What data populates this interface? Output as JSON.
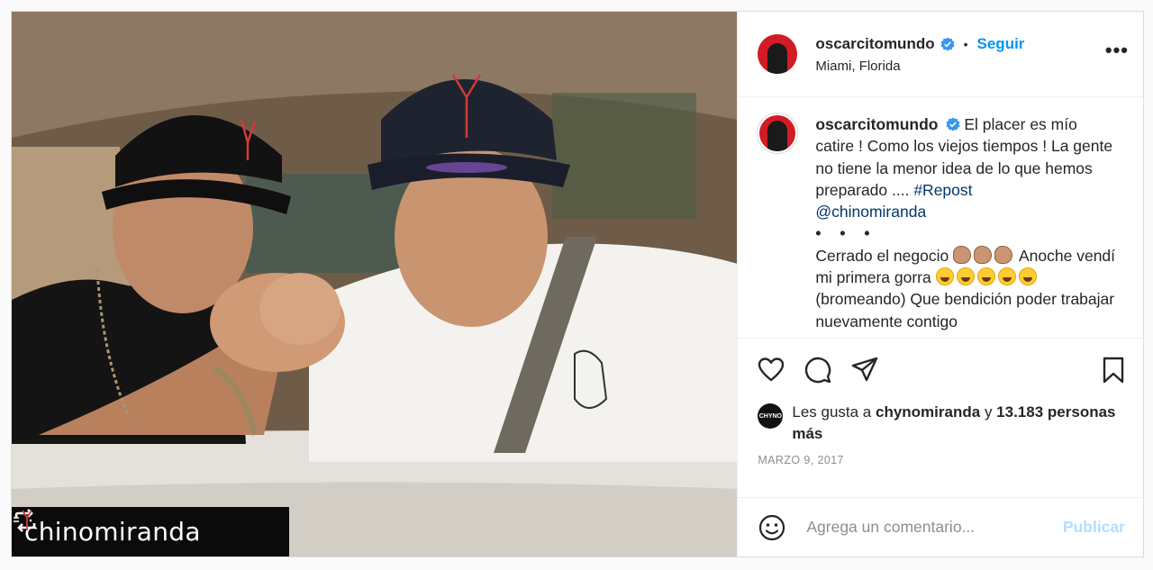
{
  "post": {
    "username": "oscarcitomundo",
    "follow_label": "Seguir",
    "location": "Miami, Florida",
    "more_icon": "more-horizontal-icon",
    "photo": {
      "repost_user": "chinomiranda"
    },
    "caption": {
      "username": "oscarcitomundo",
      "text1": "El placer es mío catire ! Como los viejos tiempos ! La gente no tiene la menor idea de lo que hemos preparado .... ",
      "hashtag": "#Repost",
      "mention": "@chinomiranda",
      "dots": "• • •",
      "text2": "Cerrado el negocio",
      "text3": " Anoche vendí mi primera gorra ",
      "text4": "(bromeando) Que bendición poder trabajar nuevamente contigo"
    },
    "actions": {
      "like_icon": "heart-icon",
      "comment_icon": "comment-icon",
      "share_icon": "share-icon",
      "save_icon": "bookmark-icon"
    },
    "likes": {
      "avatar_label": "CHYNO",
      "prefix": "Les gusta a",
      "user": "chynomiranda",
      "conjunction": "y",
      "count": "13.183",
      "suffix": "personas más"
    },
    "date": "MARZO 9, 2017",
    "comment": {
      "placeholder": "Agrega un comentario...",
      "publish_label": "Publicar"
    }
  },
  "colors": {
    "accent": "#0095f6",
    "publish_disabled": "#b2dffc",
    "avatar_bg": "#d21b24",
    "link": "#00376b"
  }
}
